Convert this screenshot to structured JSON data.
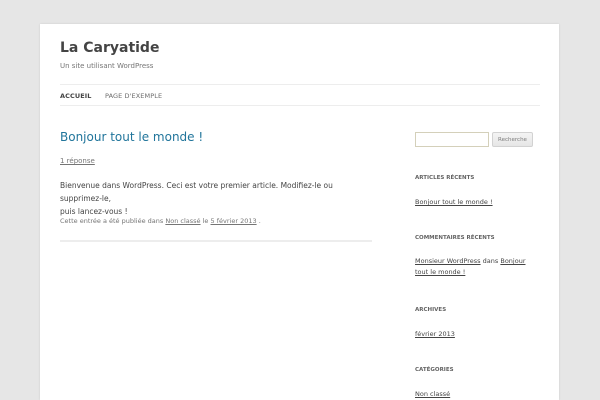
{
  "site": {
    "title": "La Caryatide",
    "description": "Un site utilisant WordPress"
  },
  "nav": {
    "items": [
      {
        "label": "ACCUEIL",
        "current": true
      },
      {
        "label": "PAGE D'EXEMPLE",
        "current": false
      }
    ]
  },
  "post": {
    "title": "Bonjour tout le monde !",
    "comments_link": "1 réponse",
    "body_line1": "Bienvenue dans WordPress. Ceci est votre premier article. Modifiez-le ou supprimez-le,",
    "body_line2": "puis lancez-vous !",
    "meta_prefix": "Cette entrée a été publiée dans",
    "meta_category": "Non classé",
    "meta_on": "le",
    "meta_date": "5 février 2013",
    "meta_end": "."
  },
  "sidebar": {
    "search": {
      "placeholder": "",
      "button_label": "Recherche"
    },
    "recent_posts": {
      "title": "ARTICLES RÉCENTS",
      "items": [
        "Bonjour tout le monde !"
      ]
    },
    "recent_comments": {
      "title": "COMMENTAIRES RÉCENTS",
      "author": "Monsieur WordPress",
      "in": "dans",
      "post_link": "Bonjour tout le monde !"
    },
    "archives": {
      "title": "ARCHIVES",
      "items": [
        "février 2013"
      ]
    },
    "categories": {
      "title": "CATÉGORIES",
      "items": [
        "Non classé"
      ]
    }
  },
  "colors": {
    "background": "#e6e6e6",
    "link_blue": "#21759b",
    "text": "#444444"
  }
}
